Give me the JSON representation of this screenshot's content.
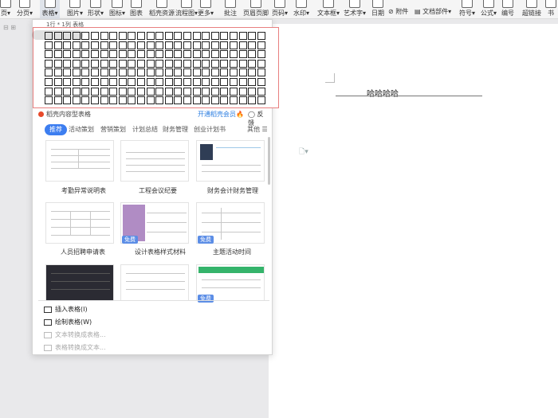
{
  "ribbon": {
    "items": [
      {
        "label": "页▾"
      },
      {
        "label": "分页▾"
      },
      {
        "label": "表格▾"
      },
      {
        "label": "图片▾"
      },
      {
        "label": "形状▾"
      },
      {
        "label": "图标▾"
      },
      {
        "label": "图表"
      },
      {
        "label": "稻壳资源"
      },
      {
        "label": "流程图▾"
      },
      {
        "label": "更多▾"
      },
      {
        "label": "批注"
      },
      {
        "label": "页眉页脚"
      },
      {
        "label": "页码▾"
      },
      {
        "label": "水印▾"
      },
      {
        "label": "文本框▾"
      },
      {
        "label": "艺术字▾"
      },
      {
        "label": "日期"
      },
      {
        "label": "附件"
      },
      {
        "label": "文档部件▾"
      },
      {
        "label": "符号▾"
      },
      {
        "label": "公式▾"
      },
      {
        "label": "编号"
      },
      {
        "label": "超链接"
      },
      {
        "label": "书"
      }
    ]
  },
  "table_picker": {
    "status": "1行 * 1列 表格"
  },
  "promo": {
    "left": "稻壳内容型表格",
    "right": "开通稻壳会员🔥",
    "feedback": "反馈"
  },
  "tabs": [
    {
      "label": "推荐"
    },
    {
      "label": "活动策划"
    },
    {
      "label": "营销策划"
    },
    {
      "label": "计划总结"
    },
    {
      "label": "财务管理"
    },
    {
      "label": "创业计划书"
    }
  ],
  "more_tab": "其他 ☰",
  "templates": [
    {
      "name": "考勤异常说明表"
    },
    {
      "name": "工程会议纪要"
    },
    {
      "name": "财务会计财务管理"
    },
    {
      "name": "人员招聘申请表"
    },
    {
      "name": "设计表格样式材料"
    },
    {
      "name": "主题活动时间"
    }
  ],
  "free_badge": "免费",
  "menu": [
    {
      "label": "插入表格(I)"
    },
    {
      "label": "绘制表格(W)"
    },
    {
      "label": "文本转换成表格..."
    },
    {
      "label": "表格转换成文本..."
    }
  ],
  "document": {
    "text": "哈哈哈哈"
  },
  "colors": {
    "accent": "#3d7ef0",
    "picker_border": "#e88080"
  }
}
